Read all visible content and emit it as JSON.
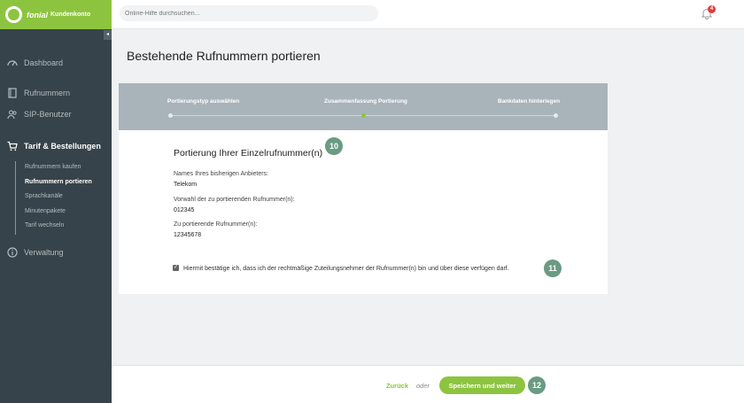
{
  "brand": {
    "name": "fonial",
    "subtitle": "Kundenkonto"
  },
  "search": {
    "placeholder": "Online-Hilfe durchsuchen..."
  },
  "notifications": {
    "count": "4"
  },
  "sidebar": {
    "collapse_glyph": "◂",
    "items": [
      {
        "label": "Dashboard"
      },
      {
        "label": "Rufnummern"
      },
      {
        "label": "SIP-Benutzer"
      },
      {
        "label": "Tarif & Bestellungen"
      },
      {
        "label": "Verwaltung"
      }
    ],
    "subitems": [
      {
        "label": "Rufnummern kaufen"
      },
      {
        "label": "Rufnummern portieren"
      },
      {
        "label": "Sprachkanäle"
      },
      {
        "label": "Minutenpakete"
      },
      {
        "label": "Tarif wechseln"
      }
    ]
  },
  "main": {
    "title": "Bestehende Rufnummern portieren",
    "steps": [
      {
        "label": "Portierungstyp auswählen"
      },
      {
        "label": "Zusammenfassung Portierung"
      },
      {
        "label": "Bankdaten hinterlegen"
      }
    ],
    "section_title": "Portierung Ihrer Einzelrufnummer(n)",
    "fields": [
      {
        "label": "Names Ihres bisherigen Anbieters:",
        "value": "Telekom"
      },
      {
        "label": "Vorwahl der zu portierenden Rufnummer(n):",
        "value": "012345"
      },
      {
        "label": "Zu portierende Rufnummer(n):",
        "value": "12345678"
      }
    ],
    "confirm_text": "Hiermit bestätige ich, dass ich der rechtmäßige Zuteilungsnehmer der Rufnummer(n) bin und über diese verfügen darf.",
    "confirm_checked_glyph": "✓",
    "markers": [
      "10",
      "11",
      "12"
    ]
  },
  "footer": {
    "back_label": "Zurück",
    "or_label": "oder",
    "save_label": "Speichern und weiter"
  },
  "colors": {
    "brand_green": "#8dc43f",
    "sidebar": "#37434a",
    "marker": "#6a9b83",
    "badge": "#e23b3b"
  }
}
